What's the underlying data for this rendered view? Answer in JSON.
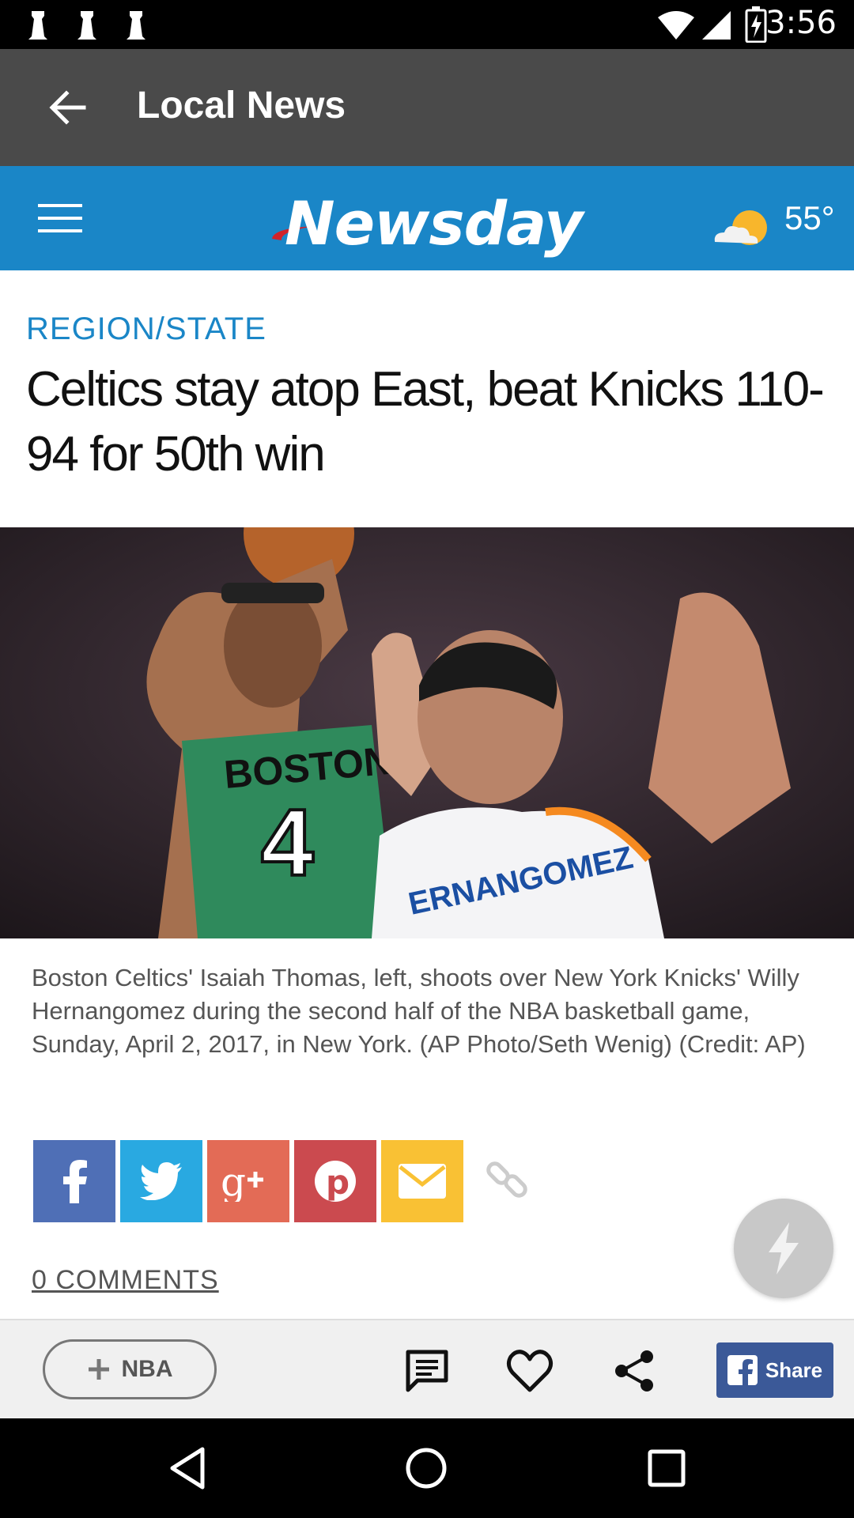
{
  "status_bar": {
    "time": "3:56"
  },
  "app_bar": {
    "title": "Local News"
  },
  "header": {
    "logo": "Newsday",
    "temperature": "55°"
  },
  "article": {
    "section": "REGION/STATE",
    "headline": "Celtics stay atop East, beat Knicks 110-94 for 50th win",
    "caption": "Boston Celtics' Isaiah Thomas, left, shoots over New York Knicks' Willy Hernangomez during the second half of the NBA basketball game, Sunday, April 2, 2017, in New York. (AP Photo/Seth Wenig) (Credit: AP)",
    "comments_link": "0 COMMENTS"
  },
  "share_buttons": [
    {
      "name": "facebook",
      "color": "#4f6fb6"
    },
    {
      "name": "twitter",
      "color": "#29a9e1"
    },
    {
      "name": "google-plus",
      "color": "#e36b56"
    },
    {
      "name": "pinterest",
      "color": "#cb4a4f"
    },
    {
      "name": "email",
      "color": "#f9c134"
    }
  ],
  "action_bar": {
    "tag_label": "NBA",
    "fb_share_label": "Share"
  },
  "colors": {
    "brand_blue": "#1a86c7",
    "app_bar": "#4a4a4a",
    "facebook": "#3b5998"
  }
}
